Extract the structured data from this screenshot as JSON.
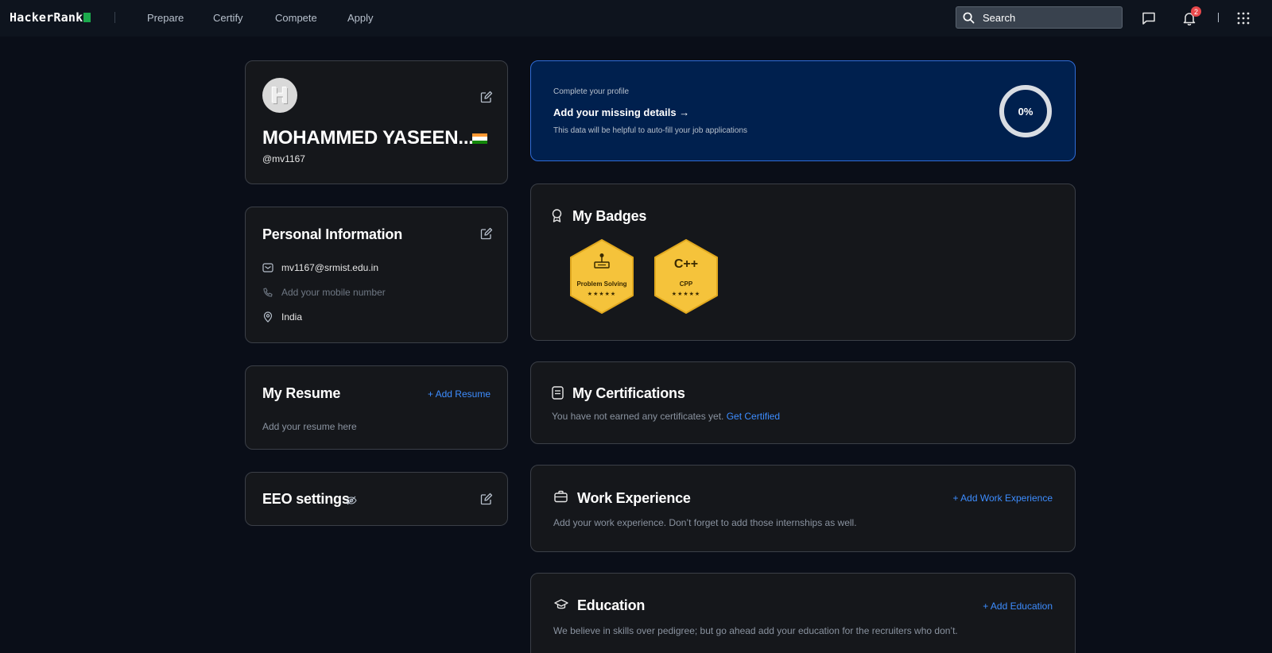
{
  "nav": {
    "logo": "HackerRank",
    "links": [
      "Prepare",
      "Certify",
      "Compete",
      "Apply"
    ],
    "search_placeholder": "Search",
    "notification_count": "2"
  },
  "profile": {
    "name": "MOHAMMED YASEEN...",
    "username": "@mv1167",
    "avatar_letter": "H"
  },
  "personal_info": {
    "title": "Personal Information",
    "email": "mv1167@srmist.edu.in",
    "phone_placeholder": "Add your mobile number",
    "location": "India"
  },
  "resume": {
    "title": "My Resume",
    "add_label": "+ Add Resume",
    "placeholder": "Add your resume here"
  },
  "eeo": {
    "title": "EEO settings"
  },
  "complete_profile": {
    "eyebrow": "Complete your profile",
    "headline": "Add your missing details →",
    "description": "This data will be helpful to auto-fill your job applications",
    "progress_text": "0%",
    "progress_value": 0
  },
  "badges": {
    "title": "My Badges",
    "items": [
      {
        "label": "Problem Solving",
        "stars": "★★★★★",
        "icon": "problem-solving-icon"
      },
      {
        "label": "CPP",
        "stars": "★★★★★",
        "icon": "cpp-icon",
        "icon_text": "C++"
      }
    ]
  },
  "certifications": {
    "title": "My Certifications",
    "description": "You have not earned any certificates yet.",
    "link": "Get Certified"
  },
  "work_experience": {
    "title": "Work Experience",
    "add_label": "+ Add Work Experience",
    "description": "Add your work experience. Don’t forget to add those internships as well."
  },
  "education": {
    "title": "Education",
    "add_label": "+ Add Education",
    "description": "We believe in skills over pedigree; but go ahead add your education for the recruiters who don’t."
  },
  "colors": {
    "background": "#0a0e18",
    "card": "#15171b",
    "accent_blue": "#3d8dff",
    "banner": "#00204e",
    "badge_gold": "#f5c33b",
    "logo_green": "#1ba94c"
  }
}
